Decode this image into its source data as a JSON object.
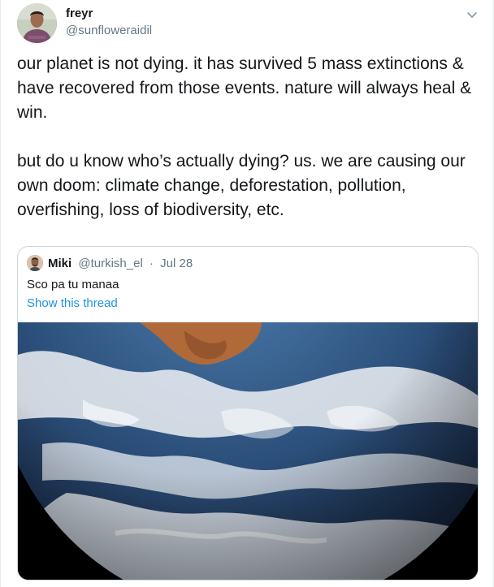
{
  "author": {
    "display_name": "freyr",
    "handle": "@sunfloweraidil"
  },
  "tweet": {
    "paragraph_1": "our planet is not dying. it has survived 5 mass extinctions & have recovered from those events. nature will always heal & win.",
    "paragraph_2": "but do u know who’s actually dying? us. we are causing our own doom: climate change, deforestation, pollution, overfishing, loss of biodiversity, etc."
  },
  "quoted_tweet": {
    "display_name": "Miki",
    "handle": "@turkish_el",
    "separator": "·",
    "date": "Jul 28",
    "text": "Sco pa tu manaa",
    "thread_link": "Show this thread"
  },
  "icons": {
    "more_menu": "chevron-down-icon"
  },
  "colors": {
    "link": "#1b95e0",
    "secondary_text": "#657786",
    "border": "#ccd6dd"
  }
}
